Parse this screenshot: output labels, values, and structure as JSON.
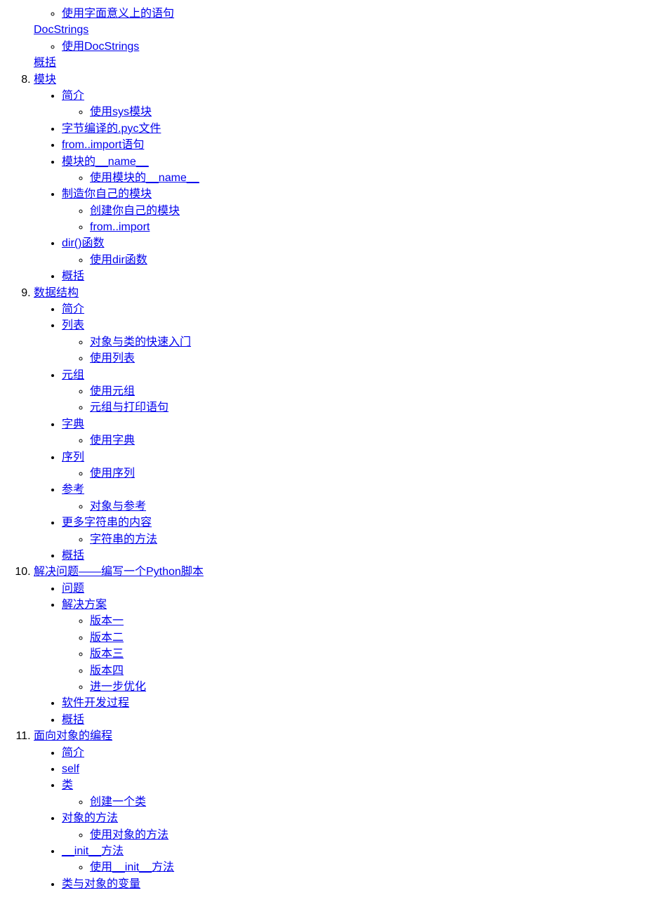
{
  "partial_top": {
    "sub_items": [
      {
        "text": "使用字面意义上的语句"
      }
    ],
    "docstrings": "DocStrings",
    "docstrings_sub": [
      {
        "text": "使用DocStrings"
      }
    ],
    "summary": "概括"
  },
  "ch8": {
    "num": "8",
    "title": "模块",
    "items": [
      {
        "text": "简介",
        "sub": [
          {
            "text": "使用sys模块"
          }
        ]
      },
      {
        "text": "字节编译的.pyc文件"
      },
      {
        "text": "from..import语句"
      },
      {
        "text": "模块的__name__",
        "sub": [
          {
            "text": "使用模块的__name__"
          }
        ]
      },
      {
        "text": "制造你自己的模块",
        "sub": [
          {
            "text": "创建你自己的模块"
          },
          {
            "text": "from..import"
          }
        ]
      },
      {
        "text": "dir()函数",
        "sub": [
          {
            "text": "使用dir函数"
          }
        ]
      },
      {
        "text": "概括"
      }
    ]
  },
  "ch9": {
    "num": "9",
    "title": "数据结构",
    "items": [
      {
        "text": "简介"
      },
      {
        "text": "列表",
        "sub": [
          {
            "text": "对象与类的快速入门"
          },
          {
            "text": "使用列表"
          }
        ]
      },
      {
        "text": "元组",
        "sub": [
          {
            "text": "使用元组"
          },
          {
            "text": "元组与打印语句"
          }
        ]
      },
      {
        "text": "字典",
        "sub": [
          {
            "text": "使用字典"
          }
        ]
      },
      {
        "text": "序列",
        "sub": [
          {
            "text": "使用序列"
          }
        ]
      },
      {
        "text": "参考",
        "sub": [
          {
            "text": "对象与参考"
          }
        ]
      },
      {
        "text": "更多字符串的内容",
        "sub": [
          {
            "text": "字符串的方法"
          }
        ]
      },
      {
        "text": "概括"
      }
    ]
  },
  "ch10": {
    "num": "10",
    "title": "解决问题——编写一个Python脚本",
    "items": [
      {
        "text": "问题"
      },
      {
        "text": "解决方案",
        "sub": [
          {
            "text": "版本一"
          },
          {
            "text": "版本二"
          },
          {
            "text": "版本三"
          },
          {
            "text": "版本四"
          },
          {
            "text": "进一步优化"
          }
        ]
      },
      {
        "text": "软件开发过程"
      },
      {
        "text": "概括"
      }
    ]
  },
  "ch11": {
    "num": "11",
    "title": "面向对象的编程",
    "items": [
      {
        "text": "简介"
      },
      {
        "text": "self"
      },
      {
        "text": "类",
        "sub": [
          {
            "text": "创建一个类"
          }
        ]
      },
      {
        "text": "对象的方法",
        "sub": [
          {
            "text": "使用对象的方法"
          }
        ]
      },
      {
        "text": "__init__方法",
        "sub": [
          {
            "text": "使用__init__方法"
          }
        ]
      },
      {
        "text": "类与对象的变量"
      }
    ]
  }
}
